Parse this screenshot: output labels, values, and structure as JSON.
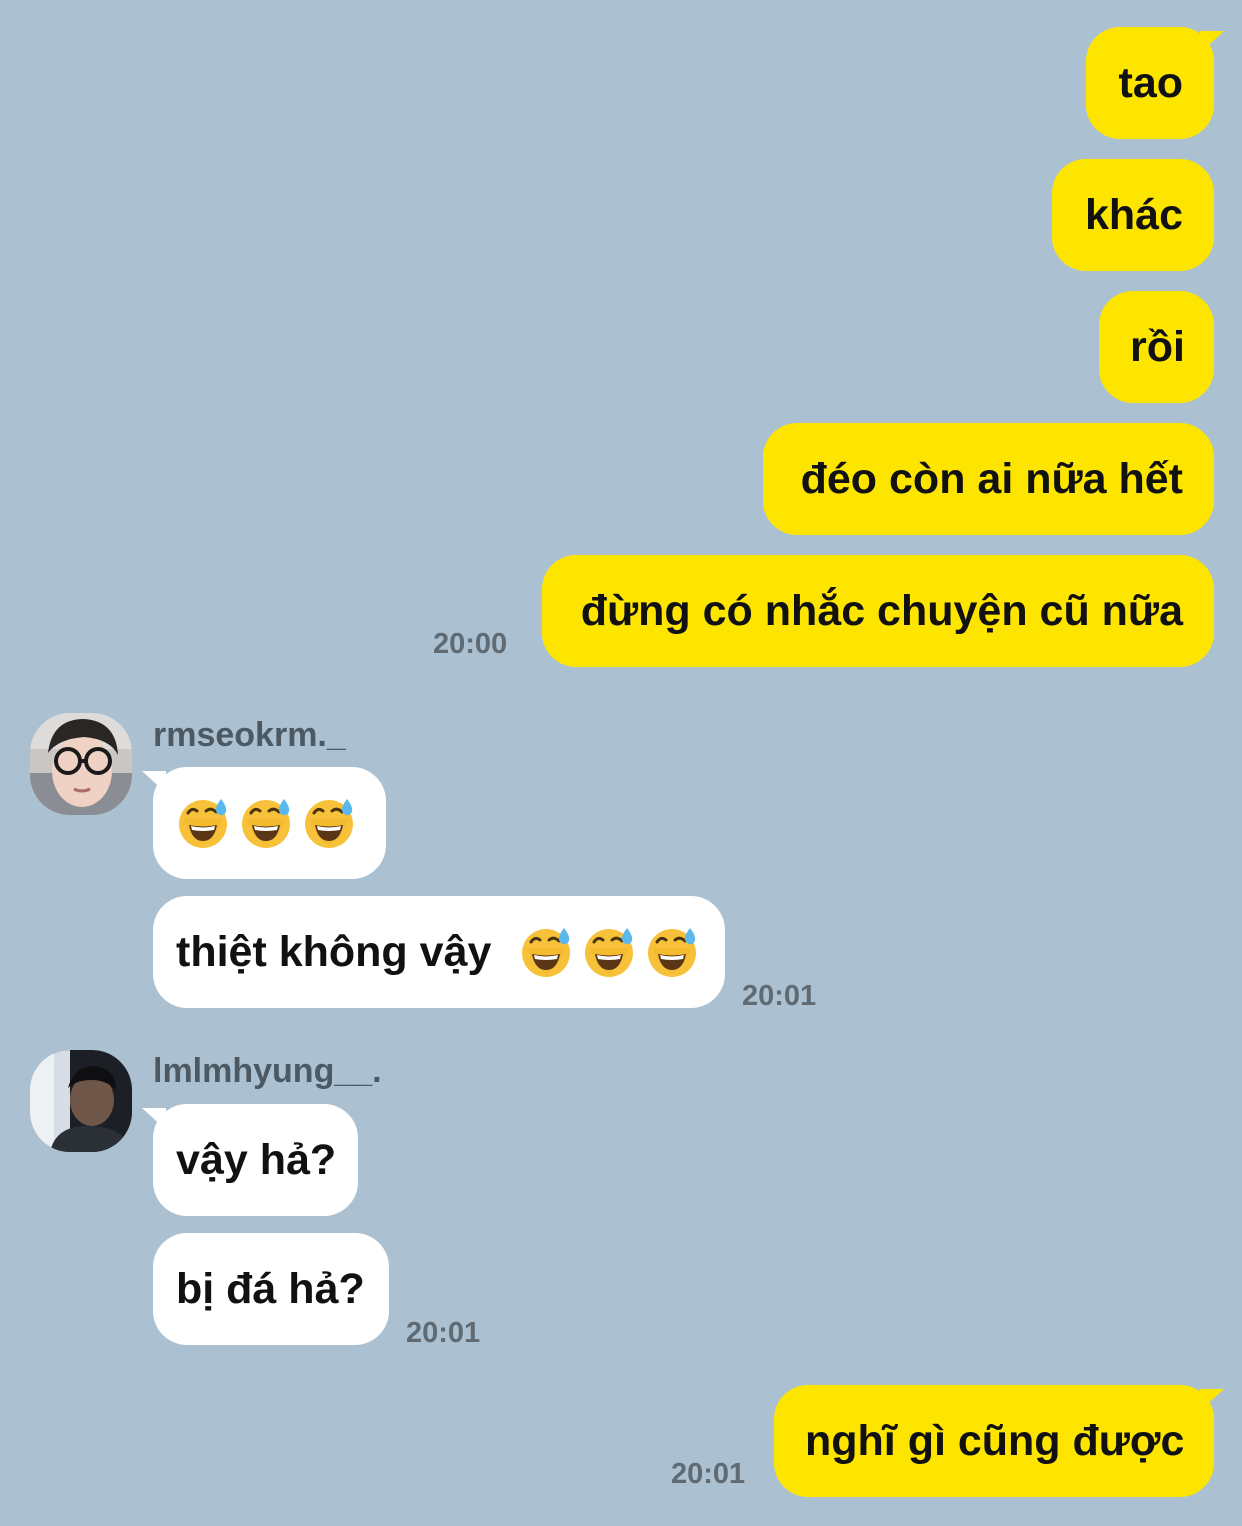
{
  "messages": {
    "m1": "tao",
    "m2": "khác",
    "m3": "rồi",
    "m4": "đéo còn ai nữa hết",
    "m5": "đừng có nhắc chuyện cũ nữa",
    "m6_emoji": "😅😅😅",
    "m7_text": "thiệt không vậy",
    "m7_emoji": "😅😅😅",
    "m8": "vậy hả?",
    "m9": "bị đá hả?",
    "m10": "nghĩ gì cũng được"
  },
  "senders": {
    "s1": "rmseokrm._",
    "s2": "lmlmhyung__."
  },
  "times": {
    "t1": "20:00",
    "t2": "20:01",
    "t3": "20:01",
    "t4": "20:01"
  },
  "emoji_name": "grinning-face-with-sweat",
  "colors": {
    "background": "#abc1d1",
    "my_bubble": "#fee500",
    "their_bubble": "#ffffff",
    "time_text": "#5f6a72"
  }
}
